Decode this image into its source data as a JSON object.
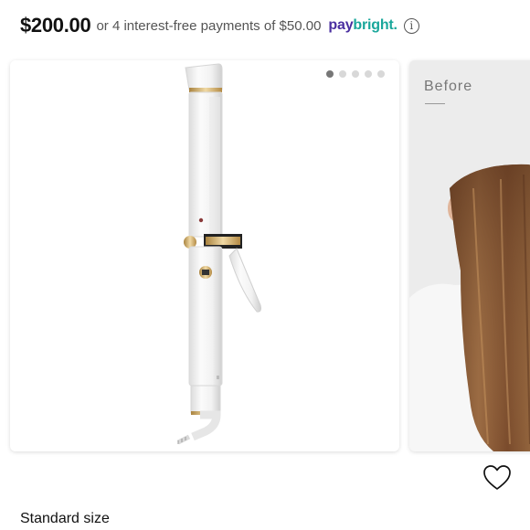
{
  "pricing": {
    "price": "$200.00",
    "installment_text": "or 4 interest-free payments of $50.00",
    "provider_pay": "pay",
    "provider_bright": "bright",
    "provider_dot": ".",
    "info_icon": "info-icon"
  },
  "carousel": {
    "slide_count": 5,
    "active_index": 0,
    "main_image": "curling-iron",
    "next_card": {
      "label": "Before",
      "image": "long-hair-back-view"
    }
  },
  "actions": {
    "wishlist_icon": "heart-icon"
  },
  "product": {
    "size_label": "Standard size"
  },
  "colors": {
    "paybright_purple": "#4a2fa0",
    "paybright_teal": "#1aa79b",
    "gold_accent": "#c9a25e"
  }
}
